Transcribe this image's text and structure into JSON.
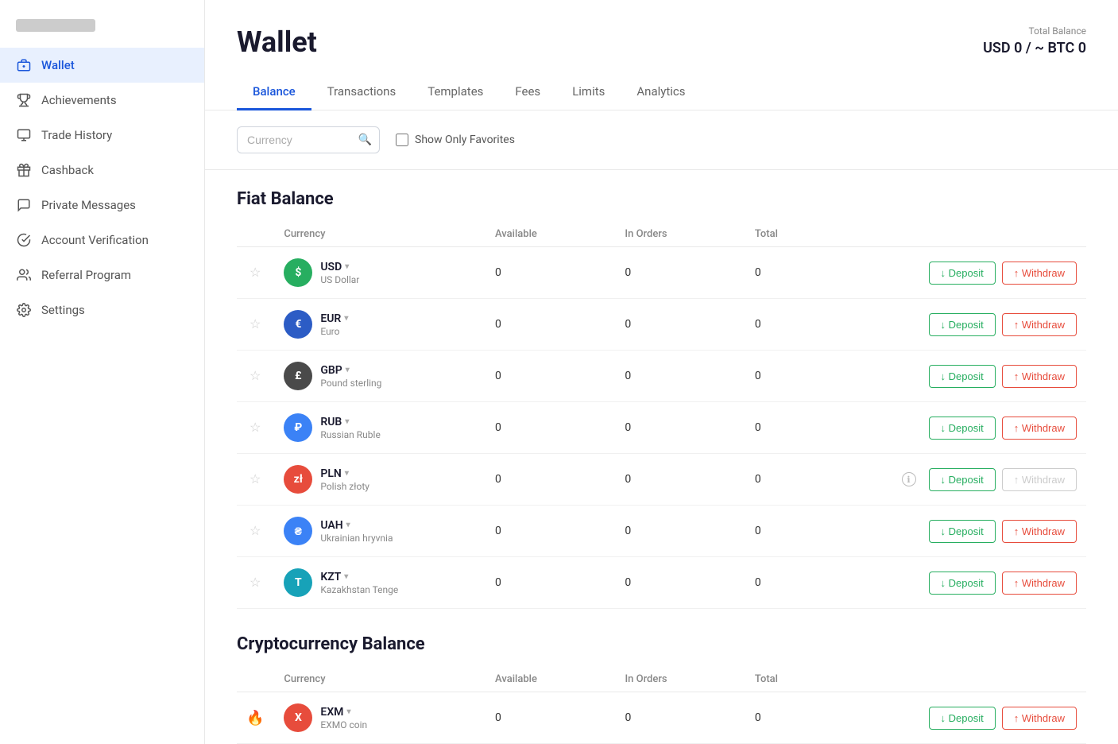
{
  "sidebar": {
    "logo_placeholder": "logo",
    "items": [
      {
        "id": "wallet",
        "label": "Wallet",
        "icon": "wallet",
        "active": true
      },
      {
        "id": "achievements",
        "label": "Achievements",
        "icon": "trophy",
        "active": false
      },
      {
        "id": "trade-history",
        "label": "Trade History",
        "icon": "monitor",
        "active": false
      },
      {
        "id": "cashback",
        "label": "Cashback",
        "icon": "gift",
        "active": false
      },
      {
        "id": "private-messages",
        "label": "Private Messages",
        "icon": "message",
        "active": false
      },
      {
        "id": "account-verification",
        "label": "Account Verification",
        "icon": "check-circle",
        "active": false
      },
      {
        "id": "referral-program",
        "label": "Referral Program",
        "icon": "users",
        "active": false
      },
      {
        "id": "settings",
        "label": "Settings",
        "icon": "gear",
        "active": false
      }
    ]
  },
  "header": {
    "page_title": "Wallet",
    "total_balance_label": "Total Balance",
    "total_balance_value": "USD 0 / ~ BTC 0"
  },
  "tabs": [
    {
      "id": "balance",
      "label": "Balance",
      "active": true
    },
    {
      "id": "transactions",
      "label": "Transactions",
      "active": false
    },
    {
      "id": "templates",
      "label": "Templates",
      "active": false
    },
    {
      "id": "fees",
      "label": "Fees",
      "active": false
    },
    {
      "id": "limits",
      "label": "Limits",
      "active": false
    },
    {
      "id": "analytics",
      "label": "Analytics",
      "active": false
    }
  ],
  "filter": {
    "search_placeholder": "Currency",
    "favorites_label": "Show Only Favorites"
  },
  "fiat_section": {
    "title": "Fiat Balance",
    "columns": [
      "Currency",
      "Available",
      "In Orders",
      "Total"
    ],
    "rows": [
      {
        "code": "USD",
        "name": "US Dollar",
        "icon_color": "#27ae60",
        "icon_letter": "$",
        "available": "0",
        "in_orders": "0",
        "total": "0",
        "withdraw_disabled": false
      },
      {
        "code": "EUR",
        "name": "Euro",
        "icon_color": "#2c5cc5",
        "icon_letter": "€",
        "available": "0",
        "in_orders": "0",
        "total": "0",
        "withdraw_disabled": false
      },
      {
        "code": "GBP",
        "name": "Pound sterling",
        "icon_color": "#4a4a4a",
        "icon_letter": "£",
        "available": "0",
        "in_orders": "0",
        "total": "0",
        "withdraw_disabled": false
      },
      {
        "code": "RUB",
        "name": "Russian Ruble",
        "icon_color": "#3b82f6",
        "icon_letter": "₽",
        "available": "0",
        "in_orders": "0",
        "total": "0",
        "withdraw_disabled": false
      },
      {
        "code": "PLN",
        "name": "Polish złoty",
        "icon_color": "#e74c3c",
        "icon_letter": "zł",
        "available": "0",
        "in_orders": "0",
        "total": "0",
        "withdraw_disabled": true,
        "has_info": true
      },
      {
        "code": "UAH",
        "name": "Ukrainian hryvnia",
        "icon_color": "#3b82f6",
        "icon_letter": "₴",
        "available": "0",
        "in_orders": "0",
        "total": "0",
        "withdraw_disabled": false
      },
      {
        "code": "KZT",
        "name": "Kazakhstan Tenge",
        "icon_color": "#17a2b8",
        "icon_letter": "T",
        "available": "0",
        "in_orders": "0",
        "total": "0",
        "withdraw_disabled": false
      }
    ]
  },
  "crypto_section": {
    "title": "Cryptocurrency Balance",
    "columns": [
      "Currency",
      "Available",
      "In Orders",
      "Total"
    ],
    "rows": [
      {
        "code": "EXM",
        "name": "EXMO coin",
        "icon_color": "#e74c3c",
        "icon_letter": "X",
        "available": "0",
        "in_orders": "0",
        "total": "0",
        "withdraw_disabled": false,
        "has_fire": true
      }
    ]
  },
  "buttons": {
    "deposit_label": "↓ Deposit",
    "withdraw_label": "↑ Withdraw"
  }
}
